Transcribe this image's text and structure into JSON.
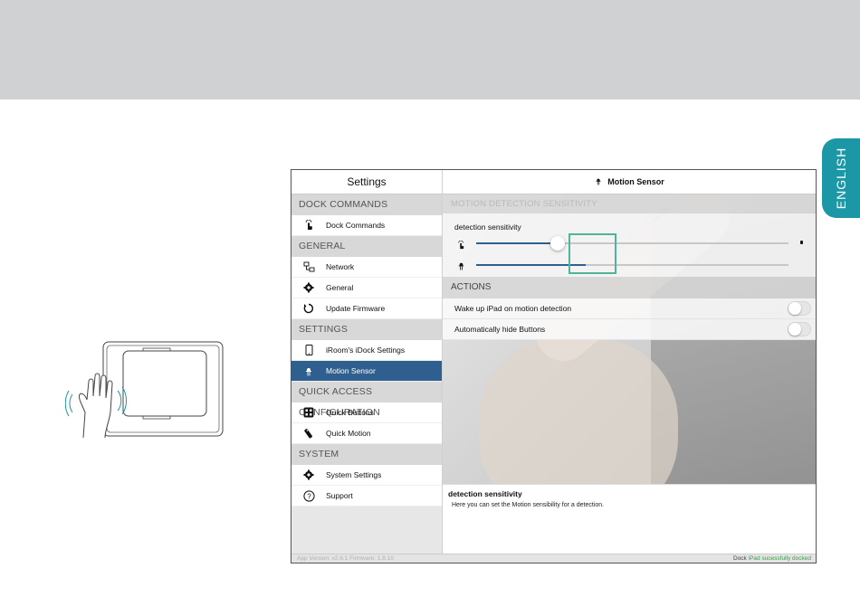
{
  "side_tab": {
    "label": "ENGLISH"
  },
  "sidebar": {
    "title": "Settings",
    "sections": [
      {
        "label": "DOCK COMMANDS",
        "items": [
          {
            "label": "Dock Commands",
            "icon": "touch-icon"
          }
        ]
      },
      {
        "label": "GENERAL",
        "items": [
          {
            "label": "Network",
            "icon": "network-icon"
          },
          {
            "label": "General",
            "icon": "gear-icon"
          },
          {
            "label": "Update Firmware",
            "icon": "refresh-icon"
          }
        ]
      },
      {
        "label": "SETTINGS",
        "items": [
          {
            "label": "iRoom's iDock Settings",
            "icon": "ipad-icon"
          },
          {
            "label": "Motion Sensor",
            "icon": "motion-sensor-icon",
            "active": true
          }
        ]
      },
      {
        "label": "QUICK ACCESS CONFIGURATION",
        "items": [
          {
            "label": "Quick Buttons",
            "icon": "grid-icon"
          },
          {
            "label": "Quick Motion",
            "icon": "remote-icon"
          }
        ]
      },
      {
        "label": "SYSTEM",
        "items": [
          {
            "label": "System Settings",
            "icon": "gear-icon"
          },
          {
            "label": "Support",
            "icon": "help-icon"
          }
        ]
      }
    ]
  },
  "main": {
    "title": "Motion Sensor",
    "sensitivity_section": "MOTION DETECTION SENSITIVITY",
    "sensitivity_label": "detection sensitivity",
    "slider_touch_level": 0.26,
    "slider_sensor_level": 0.35,
    "actions_section": "ACTIONS",
    "actions": [
      {
        "label": "Wake up iPad on motion detection",
        "enabled": false
      },
      {
        "label": "Automatically hide Buttons",
        "enabled": false
      }
    ],
    "description_title": "detection sensitivity",
    "description_text": "Here you can set the Motion sensibility for a detection."
  },
  "status_bar": {
    "version_text": "App Version: v2.6.1 Firmware: 1.8.10",
    "dock_label": "Dock",
    "dock_status": "iPad sucessfully docked"
  },
  "colors": {
    "accent": "#2e5f8f",
    "tab": "#1c97a6",
    "highlight": "#4fb59a",
    "status_ok": "#39a048"
  }
}
